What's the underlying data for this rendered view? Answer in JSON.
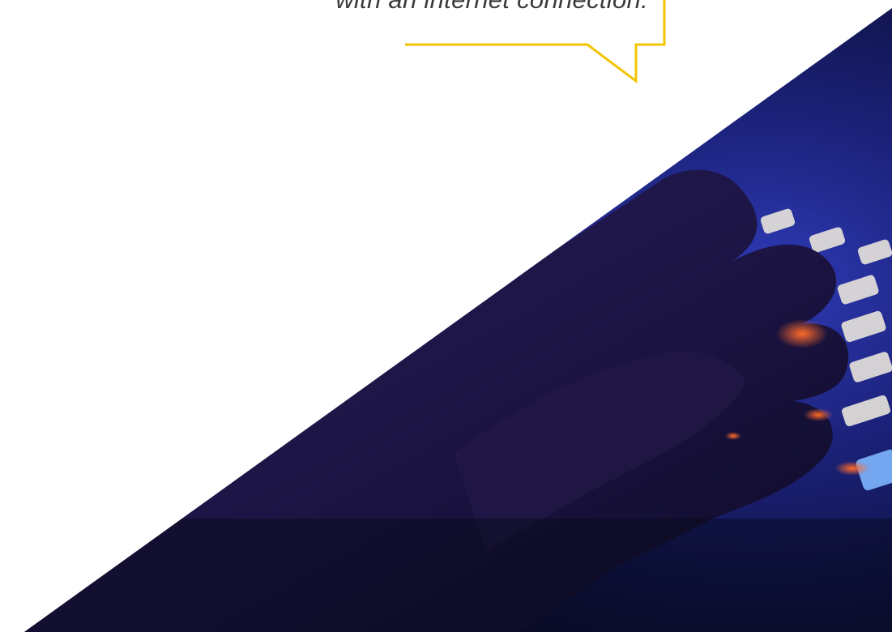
{
  "callout": {
    "text": "with an internet connection.",
    "border_color": "#f2c500"
  },
  "photo": {
    "subject": "hand typing on a backlit keyboard in the dark",
    "tint_color": "#1d1f6b",
    "key_glow_color": "#ff5a2a"
  }
}
